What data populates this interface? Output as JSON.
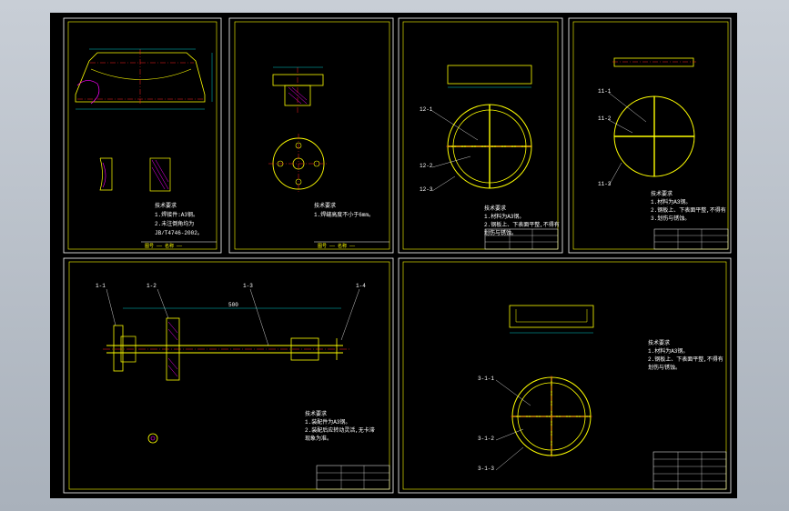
{
  "colors": {
    "background": "#000000",
    "frame": "#ffffff",
    "border": "#ffff00",
    "outline": "#ffff00",
    "dimension": "#00ffff",
    "center_line": "#ff2020",
    "hatch": "#ff00ff",
    "leader": "#ffffff",
    "text": "#ffffff"
  },
  "drawings": [
    {
      "id": "top-left-cone",
      "notes": [
        "技术要求",
        "1.焊接件:A3钢。",
        "2.未注倒角均为",
        "JB/T4746-2002。"
      ],
      "title_strip": "图号 —— 名称 ——"
    },
    {
      "id": "top-flange",
      "notes": [
        "技术要求",
        "1.焊缝高度不小于6mm。"
      ],
      "title_strip": "图号 —— 名称 ——"
    },
    {
      "id": "top-plate-ring",
      "notes": [
        "技术要求",
        "1.材料为A3钢。",
        "2.钢板上、下表面平整,不得有",
        "划伤与锈蚀。"
      ],
      "leaders": [
        "12-1",
        "12-2",
        "12-3"
      ]
    },
    {
      "id": "top-right-disc",
      "notes": [
        "技术要求",
        "1.材料为A3钢。",
        "2.钢板上、下表面平整,不得有",
        "3.划伤与锈蚀。"
      ],
      "leaders": [
        "11-1",
        "11-2",
        "11-3"
      ]
    },
    {
      "id": "bottom-left-shaft",
      "notes": [
        "技术要求",
        "1.装配件为A3钢。",
        "2.装配后应转动灵活,无卡滞",
        "现象为准。"
      ],
      "leaders": [
        "1-1",
        "1-2",
        "1-3",
        "1-4"
      ],
      "dimension": "500"
    },
    {
      "id": "bottom-right-plate",
      "notes": [
        "技术要求",
        "1.材料为A3钢。",
        "2.钢板上、下表面平整,不得有",
        "划伤与锈蚀。"
      ],
      "leaders": [
        "3-1-1",
        "3-1-2",
        "3-1-3"
      ]
    }
  ]
}
